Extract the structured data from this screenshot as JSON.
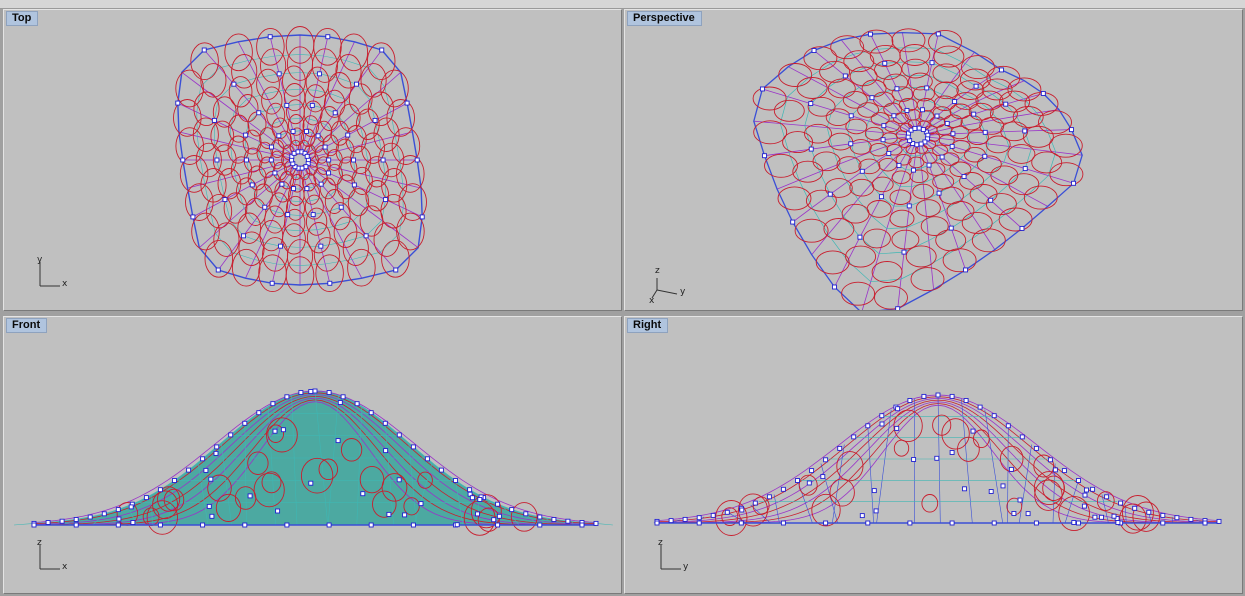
{
  "viewports": {
    "top": {
      "title": "Top",
      "axis_vertical": "y",
      "axis_horizontal": "x"
    },
    "persp": {
      "title": "Perspective",
      "axis_z": "z",
      "axis_y": "y",
      "axis_x": "x"
    },
    "front": {
      "title": "Front",
      "axis_vertical": "z",
      "axis_horizontal": "x"
    },
    "right": {
      "title": "Right",
      "axis_vertical": "z",
      "axis_horizontal": "y"
    }
  },
  "colors": {
    "background": "#c0c0c0",
    "title_bg": "#b0c4de",
    "mesh_blue": "#3a4fd6",
    "mesh_purple": "#9a33c8",
    "circle_red": "#c81e2e",
    "surface_cyan": "#3fb7b4",
    "surface_fill": "#46a8a0",
    "control_point": "#2020d0"
  }
}
